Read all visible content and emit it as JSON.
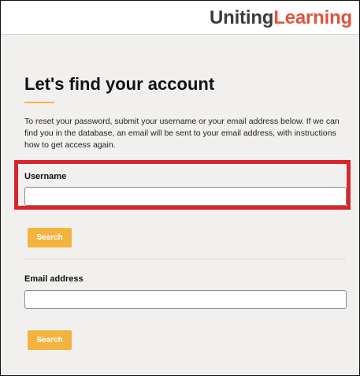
{
  "brand": {
    "part1": "Uniting",
    "part2": "Learning"
  },
  "page": {
    "title": "Let's find your account",
    "intro": "To reset your password, submit your username or your email address below. If we can find you in the database, an email will be sent to your email address, with instructions how to get access again."
  },
  "username_section": {
    "label": "Username",
    "value": "",
    "search_label": "Search",
    "highlighted": true,
    "highlight_color": "#d9262c"
  },
  "email_section": {
    "label": "Email address",
    "value": "",
    "search_label": "Search"
  },
  "colors": {
    "accent": "#f3b43f",
    "brand_dark": "#3c3c3c",
    "brand_red": "#e0533f",
    "background": "#f1f0ee"
  }
}
